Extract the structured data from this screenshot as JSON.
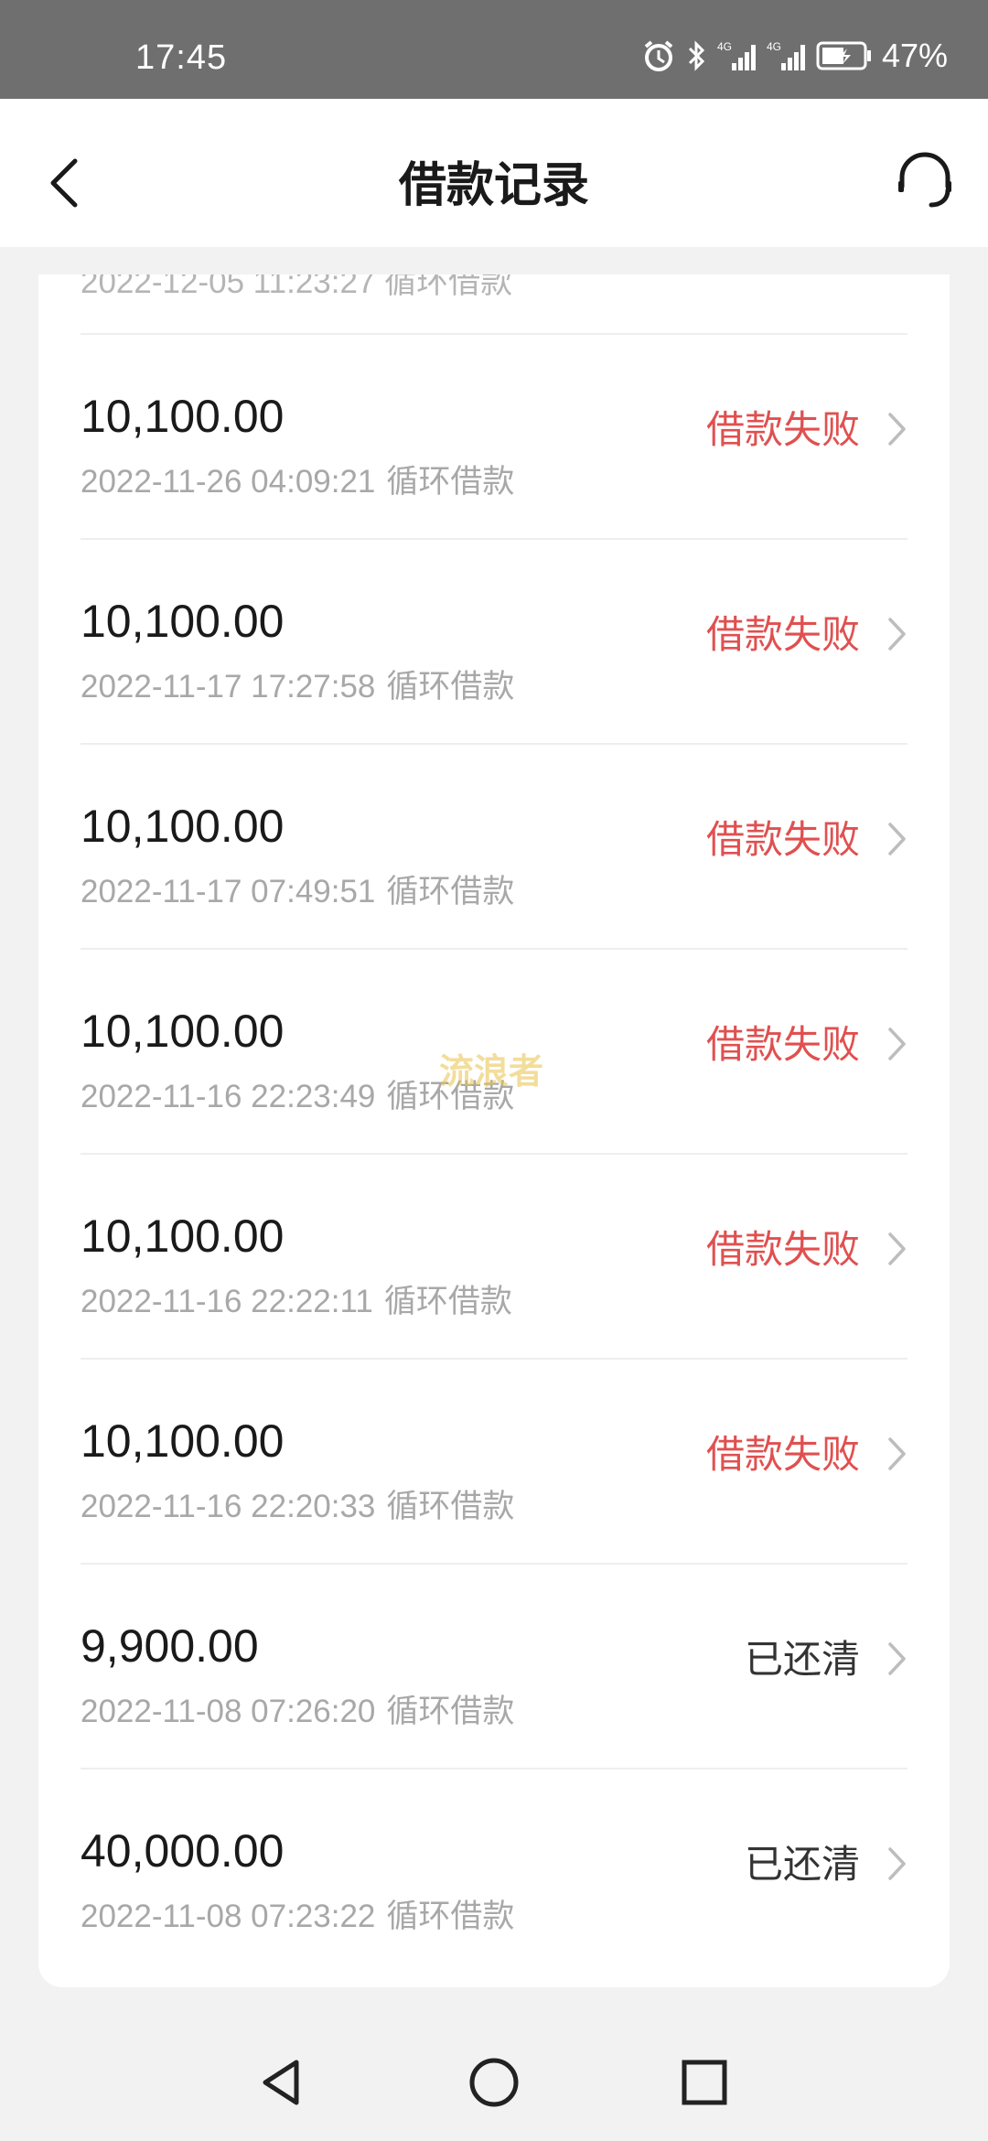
{
  "status_bar": {
    "time": "17:45",
    "battery": "47%"
  },
  "header": {
    "title": "借款记录"
  },
  "partial_row": {
    "datetime": "2022-12-05 11:23:27",
    "type": "循环借款"
  },
  "records": [
    {
      "amount": "10,100.00",
      "datetime": "2022-11-26 04:09:21",
      "type": "循环借款",
      "status": "借款失败",
      "status_kind": "failed"
    },
    {
      "amount": "10,100.00",
      "datetime": "2022-11-17 17:27:58",
      "type": "循环借款",
      "status": "借款失败",
      "status_kind": "failed"
    },
    {
      "amount": "10,100.00",
      "datetime": "2022-11-17 07:49:51",
      "type": "循环借款",
      "status": "借款失败",
      "status_kind": "failed"
    },
    {
      "amount": "10,100.00",
      "datetime": "2022-11-16 22:23:49",
      "type": "循环借款",
      "status": "借款失败",
      "status_kind": "failed"
    },
    {
      "amount": "10,100.00",
      "datetime": "2022-11-16 22:22:11",
      "type": "循环借款",
      "status": "借款失败",
      "status_kind": "failed"
    },
    {
      "amount": "10,100.00",
      "datetime": "2022-11-16 22:20:33",
      "type": "循环借款",
      "status": "借款失败",
      "status_kind": "failed"
    },
    {
      "amount": "9,900.00",
      "datetime": "2022-11-08 07:26:20",
      "type": "循环借款",
      "status": "已还清",
      "status_kind": "repaid"
    },
    {
      "amount": "40,000.00",
      "datetime": "2022-11-08 07:23:22",
      "type": "循环借款",
      "status": "已还清",
      "status_kind": "repaid"
    }
  ],
  "watermark": "流浪者",
  "colors": {
    "failed": "#e05050",
    "repaid": "#333333",
    "status_bar": "#6f6f6f"
  },
  "icons": {
    "back": "back-arrow-icon",
    "support": "headset-icon",
    "chevron": "chevron-right-icon",
    "nav_back": "triangle-back-icon",
    "nav_home": "circle-home-icon",
    "nav_recent": "square-recent-icon"
  }
}
